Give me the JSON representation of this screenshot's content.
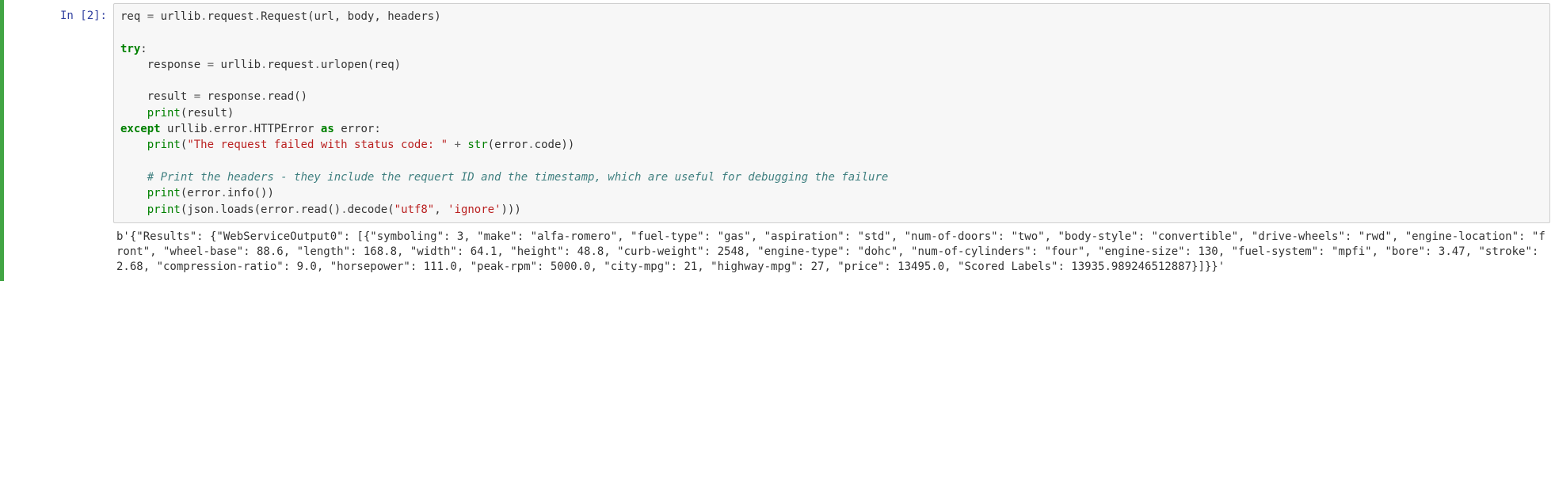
{
  "cell": {
    "prompt": "In [2]:",
    "code": {
      "lines": [
        [
          {
            "cls": "tok-name",
            "t": "req "
          },
          {
            "cls": "tok-op",
            "t": "="
          },
          {
            "cls": "tok-name",
            "t": " urllib"
          },
          {
            "cls": "tok-op",
            "t": "."
          },
          {
            "cls": "tok-name",
            "t": "request"
          },
          {
            "cls": "tok-op",
            "t": "."
          },
          {
            "cls": "tok-name",
            "t": "Request(url, body, headers)"
          }
        ],
        [],
        [
          {
            "cls": "tok-kw",
            "t": "try"
          },
          {
            "cls": "tok-name",
            "t": ":"
          }
        ],
        [
          {
            "cls": "tok-name",
            "t": "    response "
          },
          {
            "cls": "tok-op",
            "t": "="
          },
          {
            "cls": "tok-name",
            "t": " urllib"
          },
          {
            "cls": "tok-op",
            "t": "."
          },
          {
            "cls": "tok-name",
            "t": "request"
          },
          {
            "cls": "tok-op",
            "t": "."
          },
          {
            "cls": "tok-name",
            "t": "urlopen(req)"
          }
        ],
        [],
        [
          {
            "cls": "tok-name",
            "t": "    result "
          },
          {
            "cls": "tok-op",
            "t": "="
          },
          {
            "cls": "tok-name",
            "t": " response"
          },
          {
            "cls": "tok-op",
            "t": "."
          },
          {
            "cls": "tok-name",
            "t": "read()"
          }
        ],
        [
          {
            "cls": "tok-name",
            "t": "    "
          },
          {
            "cls": "tok-builtin",
            "t": "print"
          },
          {
            "cls": "tok-name",
            "t": "(result)"
          }
        ],
        [
          {
            "cls": "tok-kw",
            "t": "except"
          },
          {
            "cls": "tok-name",
            "t": " urllib"
          },
          {
            "cls": "tok-op",
            "t": "."
          },
          {
            "cls": "tok-name",
            "t": "error"
          },
          {
            "cls": "tok-op",
            "t": "."
          },
          {
            "cls": "tok-name",
            "t": "HTTPError "
          },
          {
            "cls": "tok-kw",
            "t": "as"
          },
          {
            "cls": "tok-name",
            "t": " error:"
          }
        ],
        [
          {
            "cls": "tok-name",
            "t": "    "
          },
          {
            "cls": "tok-builtin",
            "t": "print"
          },
          {
            "cls": "tok-name",
            "t": "("
          },
          {
            "cls": "tok-str",
            "t": "\"The request failed with status code: \""
          },
          {
            "cls": "tok-name",
            "t": " "
          },
          {
            "cls": "tok-op",
            "t": "+"
          },
          {
            "cls": "tok-name",
            "t": " "
          },
          {
            "cls": "tok-builtin",
            "t": "str"
          },
          {
            "cls": "tok-name",
            "t": "(error"
          },
          {
            "cls": "tok-op",
            "t": "."
          },
          {
            "cls": "tok-name",
            "t": "code))"
          }
        ],
        [],
        [
          {
            "cls": "tok-name",
            "t": "    "
          },
          {
            "cls": "tok-comment",
            "t": "# Print the headers - they include the requert ID and the timestamp, which are useful for debugging the failure"
          }
        ],
        [
          {
            "cls": "tok-name",
            "t": "    "
          },
          {
            "cls": "tok-builtin",
            "t": "print"
          },
          {
            "cls": "tok-name",
            "t": "(error"
          },
          {
            "cls": "tok-op",
            "t": "."
          },
          {
            "cls": "tok-name",
            "t": "info())"
          }
        ],
        [
          {
            "cls": "tok-name",
            "t": "    "
          },
          {
            "cls": "tok-builtin",
            "t": "print"
          },
          {
            "cls": "tok-name",
            "t": "(json"
          },
          {
            "cls": "tok-op",
            "t": "."
          },
          {
            "cls": "tok-name",
            "t": "loads(error"
          },
          {
            "cls": "tok-op",
            "t": "."
          },
          {
            "cls": "tok-name",
            "t": "read()"
          },
          {
            "cls": "tok-op",
            "t": "."
          },
          {
            "cls": "tok-name",
            "t": "decode("
          },
          {
            "cls": "tok-str",
            "t": "\"utf8\""
          },
          {
            "cls": "tok-name",
            "t": ", "
          },
          {
            "cls": "tok-str",
            "t": "'ignore'"
          },
          {
            "cls": "tok-name",
            "t": ")))"
          }
        ]
      ]
    },
    "output_text": "b'{\"Results\": {\"WebServiceOutput0\": [{\"symboling\": 3, \"make\": \"alfa-romero\", \"fuel-type\": \"gas\", \"aspiration\": \"std\", \"num-of-doors\": \"two\", \"body-style\": \"convertible\", \"drive-wheels\": \"rwd\", \"engine-location\": \"front\", \"wheel-base\": 88.6, \"length\": 168.8, \"width\": 64.1, \"height\": 48.8, \"curb-weight\": 2548, \"engine-type\": \"dohc\", \"num-of-cylinders\": \"four\", \"engine-size\": 130, \"fuel-system\": \"mpfi\", \"bore\": 3.47, \"stroke\": 2.68, \"compression-ratio\": 9.0, \"horsepower\": 111.0, \"peak-rpm\": 5000.0, \"city-mpg\": 21, \"highway-mpg\": 27, \"price\": 13495.0, \"Scored Labels\": 13935.989246512887}]}}'"
  }
}
